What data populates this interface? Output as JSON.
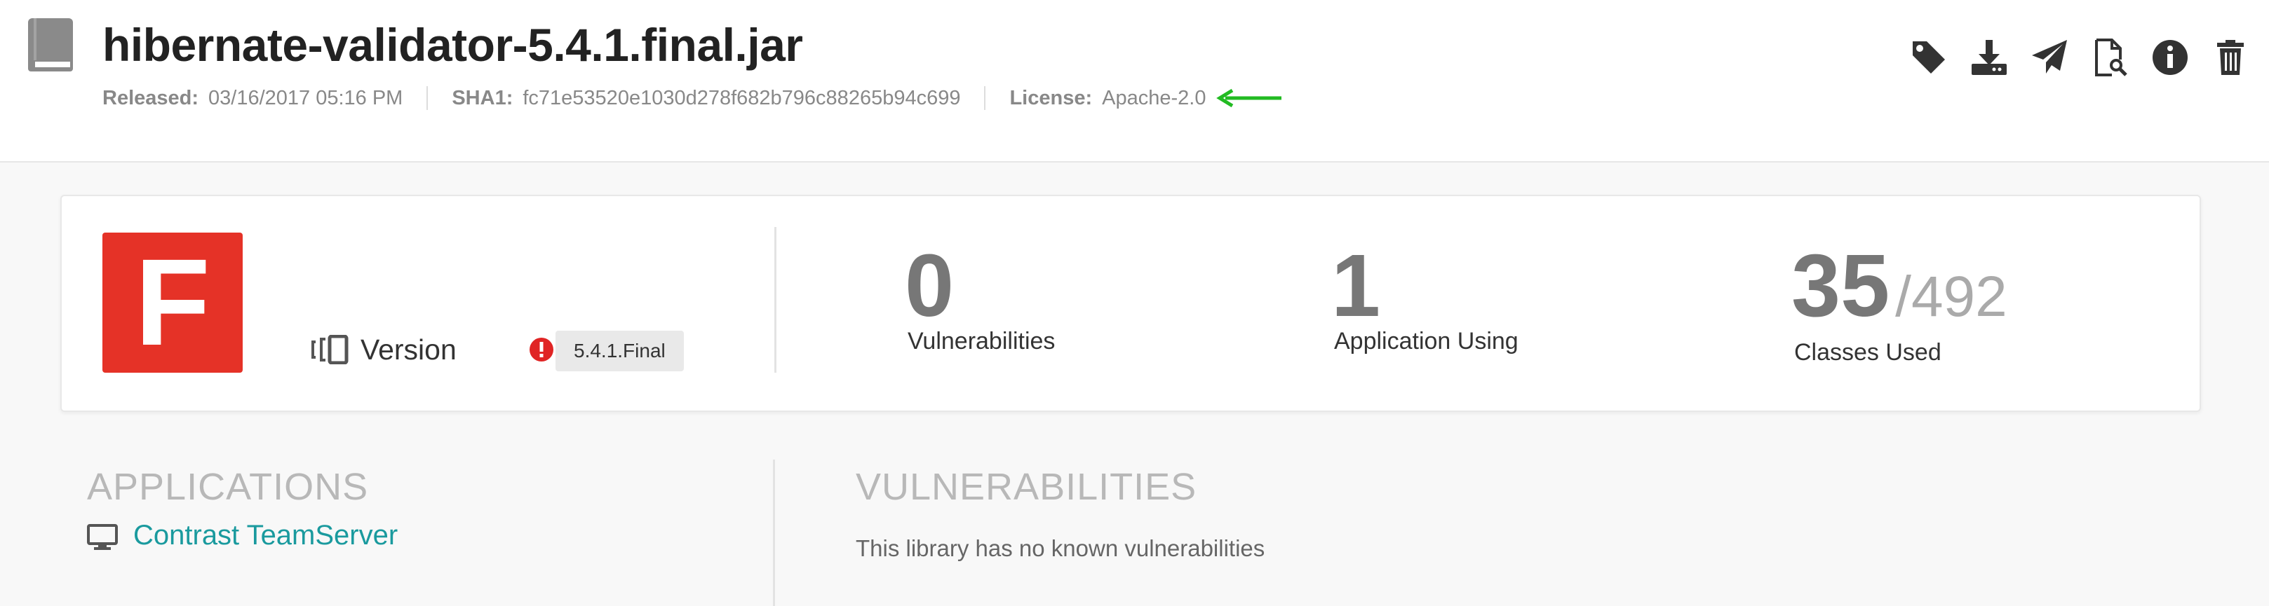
{
  "header": {
    "title": "hibernate-validator-5.4.1.final.jar",
    "released_label": "Released:",
    "released_value": "03/16/2017 05:16 PM",
    "sha1_label": "SHA1:",
    "sha1_value": "fc71e53520e1030d278f682b796c88265b94c699",
    "license_label": "License:",
    "license_value": "Apache-2.0",
    "arrow_color": "#22bb22"
  },
  "toolbar": {
    "tag_icon": "tag-icon",
    "download_icon": "download-icon",
    "send_icon": "send-icon",
    "inspect_icon": "document-search-icon",
    "info_icon": "info-icon",
    "delete_icon": "trash-icon"
  },
  "summary": {
    "grade": "F",
    "grade_color": "#e53227",
    "version_label": "Version",
    "version_value": "5.4.1.Final",
    "alert_color": "#e02424",
    "stats": [
      {
        "value": "0",
        "label": "Vulnerabilities"
      },
      {
        "value": "1",
        "label": "Application Using"
      },
      {
        "value": "35",
        "total": "/492",
        "label": "Classes Used"
      }
    ]
  },
  "applications": {
    "title": "APPLICATIONS",
    "items": [
      "Contrast TeamServer"
    ],
    "link_color": "#1a9a9e"
  },
  "vulnerabilities": {
    "title": "VULNERABILITIES",
    "empty_text": "This library has no known vulnerabilities"
  }
}
